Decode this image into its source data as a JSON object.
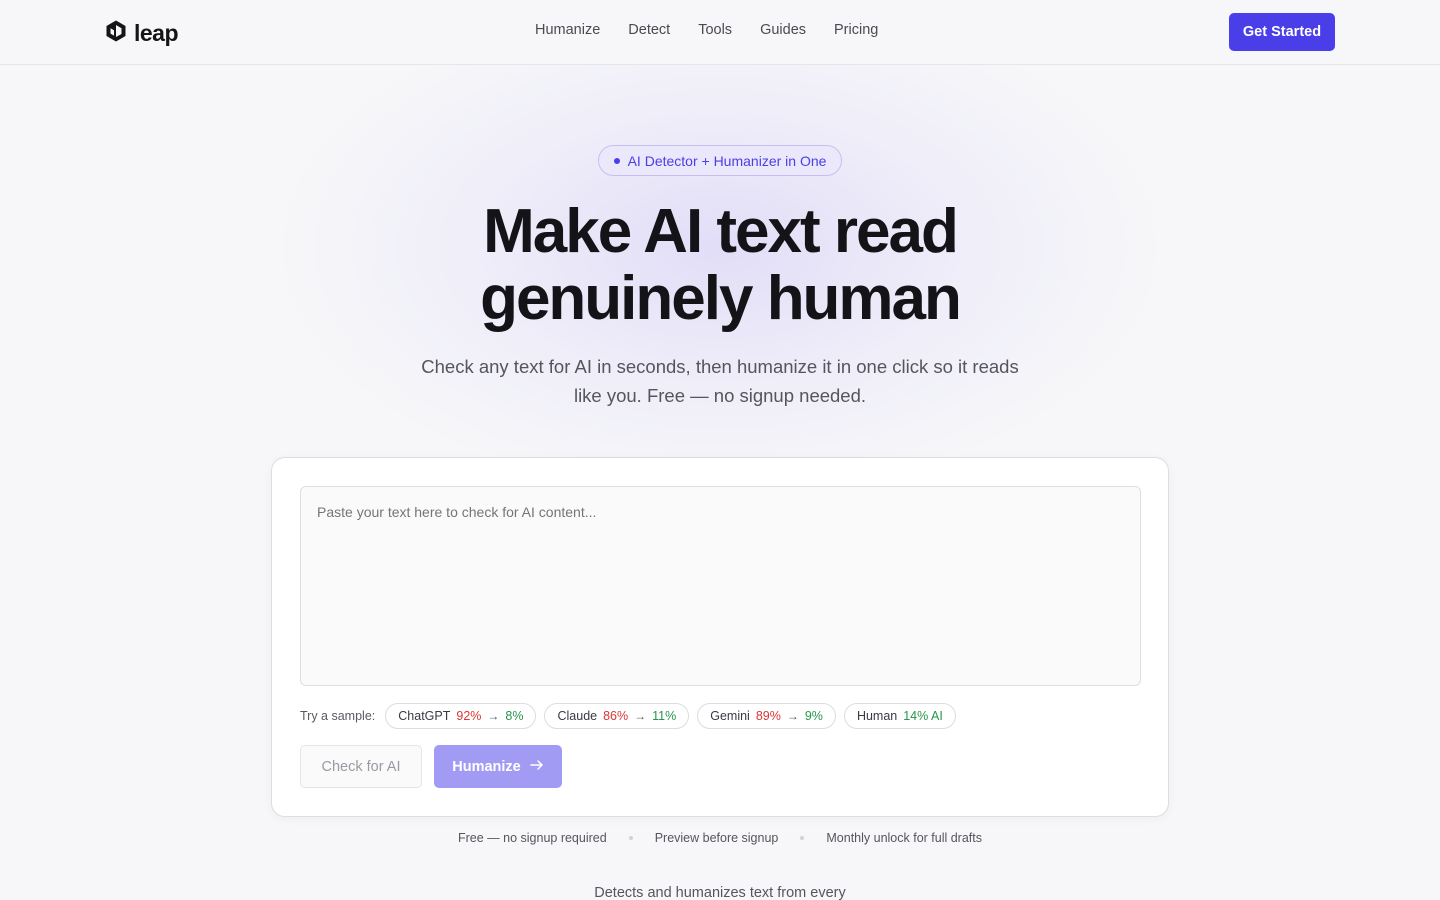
{
  "brand": {
    "name": "leap"
  },
  "nav": {
    "items": [
      "Humanize",
      "Detect",
      "Tools",
      "Guides",
      "Pricing"
    ]
  },
  "header": {
    "cta_label": "Get Started"
  },
  "hero": {
    "badge": "AI Detector + Humanizer in One",
    "title_line1": "Make AI text read",
    "title_line2": "genuinely human",
    "subtitle": "Check any text for AI in seconds, then humanize it in one click so it reads like you. Free — no signup needed."
  },
  "tool": {
    "placeholder": "Paste your text here to check for AI content...",
    "samples_label": "Try a sample:",
    "samples": [
      {
        "name": "ChatGPT",
        "before": "92%",
        "after": "8%"
      },
      {
        "name": "Claude",
        "before": "86%",
        "after": "11%"
      },
      {
        "name": "Gemini",
        "before": "89%",
        "after": "9%"
      },
      {
        "name": "Human",
        "score": "14% AI"
      }
    ],
    "check_label": "Check for AI",
    "humanize_label": "Humanize"
  },
  "perks": [
    "Free — no signup required",
    "Preview before signup",
    "Monthly unlock for full drafts"
  ],
  "detects_text": "Detects and humanizes text from every",
  "colors": {
    "accent": "#4a3ee8",
    "accent_light": "#a29bf3",
    "red": "#d93636",
    "green": "#27954a"
  },
  "icons": {
    "logo": "leap-logo-icon",
    "arrow": "arrow-right-icon"
  }
}
